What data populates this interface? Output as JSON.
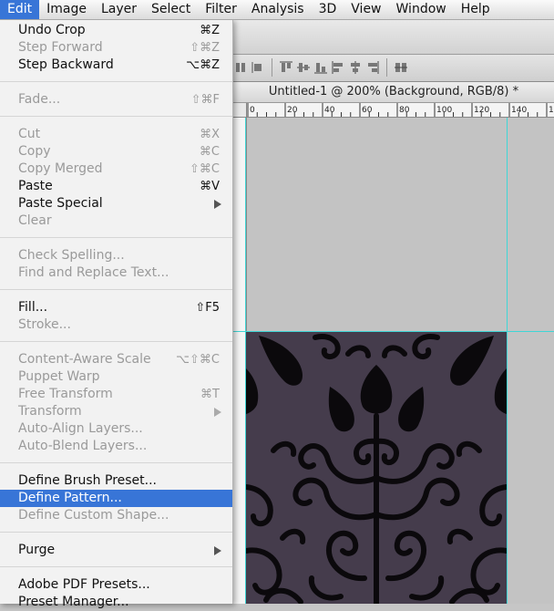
{
  "menubar": {
    "items": [
      "Edit",
      "Image",
      "Layer",
      "Select",
      "Filter",
      "Analysis",
      "3D",
      "View",
      "Window",
      "Help"
    ]
  },
  "document": {
    "title": "Untitled-1 @ 200% (Background, RGB/8) *",
    "ruler_ticks": [
      "0",
      "20",
      "40",
      "60",
      "80",
      "100",
      "120",
      "140",
      "160"
    ]
  },
  "edit_menu": {
    "undo": {
      "label": "Undo Crop",
      "shortcut": "⌘Z"
    },
    "step_forward": {
      "label": "Step Forward",
      "shortcut": "⇧⌘Z"
    },
    "step_backward": {
      "label": "Step Backward",
      "shortcut": "⌥⌘Z"
    },
    "fade": {
      "label": "Fade...",
      "shortcut": "⇧⌘F"
    },
    "cut": {
      "label": "Cut",
      "shortcut": "⌘X"
    },
    "copy": {
      "label": "Copy",
      "shortcut": "⌘C"
    },
    "copy_merged": {
      "label": "Copy Merged",
      "shortcut": "⇧⌘C"
    },
    "paste": {
      "label": "Paste",
      "shortcut": "⌘V"
    },
    "paste_special": {
      "label": "Paste Special"
    },
    "clear": {
      "label": "Clear"
    },
    "check_spelling": {
      "label": "Check Spelling..."
    },
    "find_replace": {
      "label": "Find and Replace Text..."
    },
    "fill": {
      "label": "Fill...",
      "shortcut": "⇧F5"
    },
    "stroke": {
      "label": "Stroke..."
    },
    "content_aware_scale": {
      "label": "Content-Aware Scale",
      "shortcut": "⌥⇧⌘C"
    },
    "puppet_warp": {
      "label": "Puppet Warp"
    },
    "free_transform": {
      "label": "Free Transform",
      "shortcut": "⌘T"
    },
    "transform": {
      "label": "Transform"
    },
    "auto_align": {
      "label": "Auto-Align Layers..."
    },
    "auto_blend": {
      "label": "Auto-Blend Layers..."
    },
    "define_brush": {
      "label": "Define Brush Preset..."
    },
    "define_pattern": {
      "label": "Define Pattern..."
    },
    "define_custom_shape": {
      "label": "Define Custom Shape..."
    },
    "purge": {
      "label": "Purge"
    },
    "pdf_presets": {
      "label": "Adobe PDF Presets..."
    },
    "preset_manager": {
      "label": "Preset Manager..."
    }
  },
  "colors": {
    "menu_highlight": "#3875d7",
    "pattern_background": "#453c4c",
    "pattern_ink": "#0b090c",
    "guide": "#3fd6d6"
  }
}
